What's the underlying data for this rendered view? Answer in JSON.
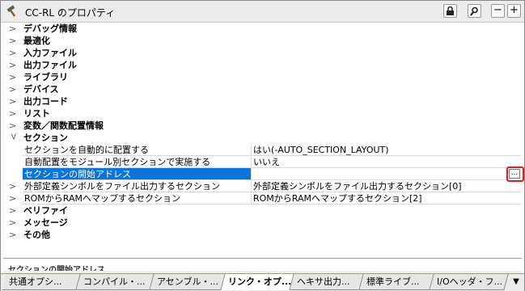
{
  "window": {
    "title": "CC-RL のプロパティ"
  },
  "toolbar": {
    "lock": "lock-icon",
    "search": "magnifier-icon",
    "minus": "−",
    "plus": "+"
  },
  "categories_top": [
    "デバッグ情報",
    "最適化",
    "入力ファイル",
    "出力ファイル",
    "ライブラリ",
    "デバイス",
    "出力コード",
    "リスト",
    "変数／関数配置情報"
  ],
  "section": {
    "label": "セクション",
    "rows": [
      {
        "name": "セクションを自動的に配置する",
        "value": "はい(-AUTO_SECTION_LAYOUT)"
      },
      {
        "name": "自動配置をモジュール別セクションで実施する",
        "value": "いいえ"
      },
      {
        "name": "セクションの開始アドレス",
        "value": "",
        "ellipsis": "..."
      },
      {
        "name": "外部定義シンボルをファイル出力するセクション",
        "value": "外部定義シンボルをファイル出力するセクション[0]"
      },
      {
        "name": "ROMからRAMへマップするセクション",
        "value": "ROMからRAMへマップするセクション[2]"
      }
    ]
  },
  "categories_bottom": [
    "ベリファイ",
    "メッセージ",
    "その他"
  ],
  "description": {
    "text": "セクションの開始アドレス"
  },
  "tabs": [
    {
      "label": "共通オプシ..."
    },
    {
      "label": "コンパイル・..."
    },
    {
      "label": "アセンブル・..."
    },
    {
      "label": "リンク・オプ..."
    },
    {
      "label": "ヘキサ出力..."
    },
    {
      "label": "標準ライブ..."
    },
    {
      "label": "I/Oヘッダ・フ..."
    }
  ],
  "active_tab": "リンク・オプ..."
}
